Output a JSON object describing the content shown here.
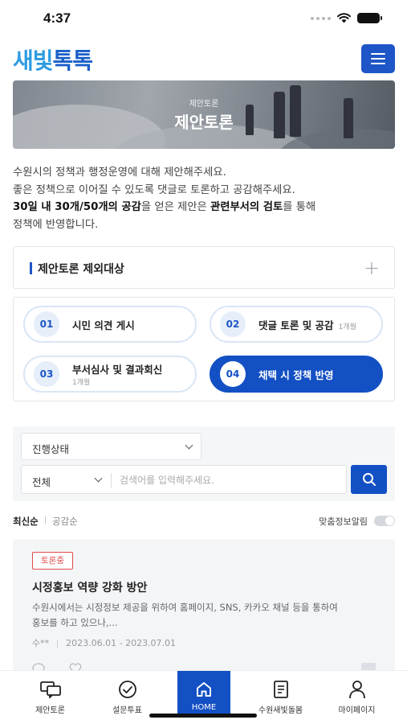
{
  "status_bar": {
    "time": "4:37"
  },
  "header": {
    "logo_part1": "새빛",
    "logo_part2": "톡톡",
    "menu_icon": "hamburger-icon"
  },
  "banner": {
    "subtitle": "제안토론",
    "title": "제안토론"
  },
  "intro": {
    "line1": "수원시의 정책과 행정운영에 대해 제안해주세요.",
    "line2": "좋은 정책으로 이어질 수 있도록 댓글로 토론하고 공감해주세요.",
    "line3_bold1": "30일 내 30개/50개의 공감",
    "line3_mid": "을 얻은 제안은 ",
    "line3_bold2": "관련부서의 검토",
    "line3_end": "를 통해",
    "line4": "정책에 반영합니다."
  },
  "exclusion": {
    "title": "제안토론 제외대상",
    "expand_icon": "plus-icon"
  },
  "steps": [
    {
      "num": "01",
      "label": "시민 의견 게시",
      "sub": ""
    },
    {
      "num": "02",
      "label": "댓글 토론 및 공감",
      "sub": "1개월"
    },
    {
      "num": "03",
      "label": "부서심사 및 결과회신",
      "sub": "1개월"
    },
    {
      "num": "04",
      "label": "채택 시 정책 반영",
      "sub": "",
      "active": true
    }
  ],
  "search": {
    "status_select": "진행상태",
    "category_select": "전체",
    "placeholder": "검색어를 입력해주세요.",
    "button_icon": "search-icon"
  },
  "sort": {
    "latest": "최신순",
    "likes": "공감순",
    "alert_label": "맞춤정보알림",
    "alert_on": false
  },
  "post": {
    "badge": "토론중",
    "title": "시정홍보 역량 강화 방안",
    "desc_line1": "수원시에서는 시정정보 제공을 위하여 홈페이지, SNS, 카카오 채널 등을 통하여",
    "desc_line2": "홍보를 하고 있으나,...",
    "author": "수**",
    "period": "2023.06.01 - 2023.07.01"
  },
  "tabbar": [
    {
      "label": "제안토론",
      "icon": "discussion-icon"
    },
    {
      "label": "설문투표",
      "icon": "check-circle-icon"
    },
    {
      "label": "HOME",
      "icon": "home-icon",
      "active": true
    },
    {
      "label": "수원새빛돌봄",
      "icon": "document-icon"
    },
    {
      "label": "마이페이지",
      "icon": "person-icon"
    }
  ],
  "colors": {
    "primary": "#1350c4",
    "logo_light": "#2d9be0",
    "logo_dark": "#1a5fc9",
    "badge_red": "#e04b4b"
  }
}
